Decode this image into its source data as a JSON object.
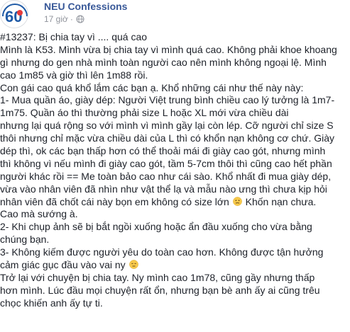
{
  "post": {
    "page_name": "NEU Confessions",
    "timestamp": "17 giờ",
    "separator": "·",
    "avatar_text": "60",
    "privacy_icon": "globe-icon",
    "lines": [
      "#13237: Bị chia tay vì .... quá cao",
      "Mình là K53. Mình vừa bị chia tay vì mình quá cao. Không phải khoe khoang",
      "gì nhưng do gen nhà mình toàn người cao nên mình không ngoại lệ. Mình",
      "cao 1m85 và giờ thì lên 1m88 rồi.",
      "Con gái cao quá khổ lắm các bạn ạ. Khổ những cái như thế này này:",
      "1- Mua quần áo, giày dép: Người Việt trung bình chiều cao lý tưởng là 1m7-",
      "1m75. Quần áo thì thường phải size L hoặc XL mới vừa chiều dài",
      "nhưng lại quá rộng so với mình vì mình gầy lại còn lép. Cỡ người chỉ size S",
      "thôi nhưng chỉ mặc vừa chiều dài của L thì có khổn nạn không cơ chứ. Giày",
      "dép thì, ok các bạn thấp hơn có thể thoải mái đi giày cao gót, nhưng mình",
      "thì không vì nếu mình đi giày cao gót, tầm 5-7cm thôi thì cũng cao hết phần",
      "người khác rồi == Me toàn bảo cao như cái sào. Khổ nhất đi mua giày dép,",
      "vừa vào nhân viên đã nhìn như vật thể lạ và mẫu nào ưng thì chưa kịp hỏi",
      "nhân viên đã chốt cái này bọn em không có size lớn",
      "Khốn nạn chưa.",
      "Cao mà sướng à.",
      "2- Khi chụp ảnh sẽ bị bắt ngồi xuống hoặc ẩn đầu xuống cho vừa bằng",
      "chúng bạn.",
      "3- Không kiếm được người yêu do toàn cao hơn. Không được tận hưởng",
      "cảm giác gục đầu vào vai ny",
      "Trở lại với chuyện bị chia tay. Ny mình cao 1m78, cũng gầy nhưng thấp",
      "hơn mình. Lúc đầu mọi chuyện rất ổn, nhưng bạn bè anh ấy ai cũng trêu",
      "chọc khiến anh ấy tự ti."
    ],
    "emojis": [
      "confused-face-emoji",
      "expressionless-face-emoji"
    ]
  },
  "colors": {
    "name": "#385898",
    "meta": "#90949c",
    "text": "#1d2129",
    "emoji": "#f7c94b"
  }
}
